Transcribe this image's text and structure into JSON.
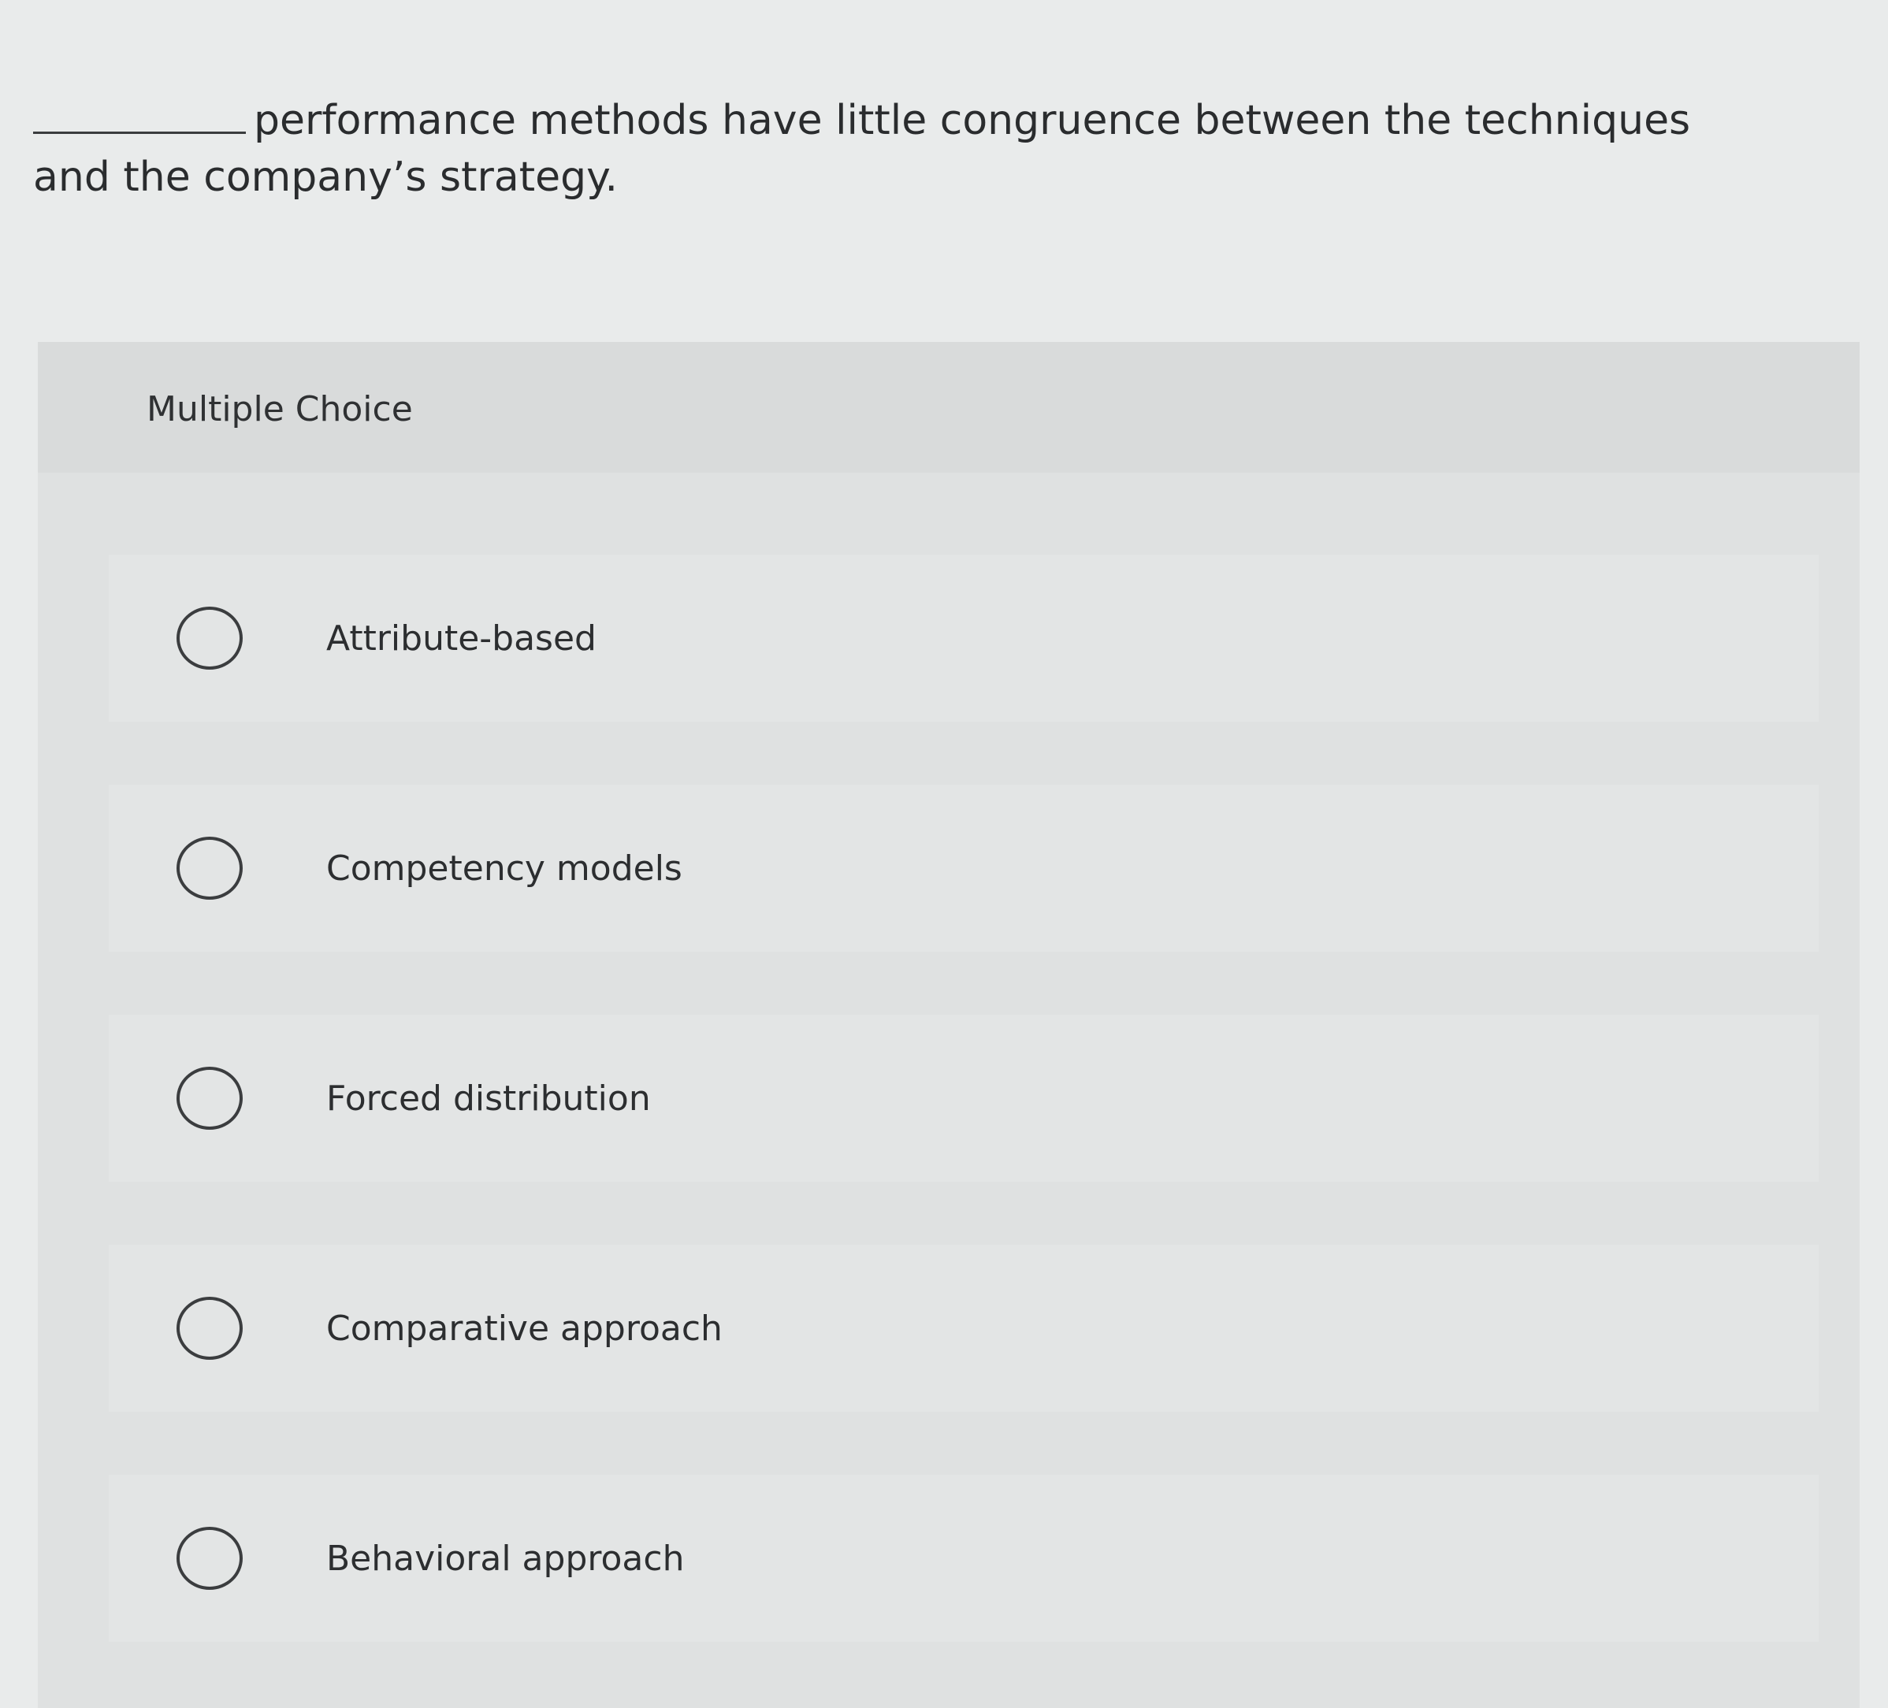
{
  "question": {
    "text": "performance methods have little congruence between the techniques and the company’s strategy."
  },
  "panel": {
    "title": "Multiple Choice"
  },
  "options": [
    {
      "label": "Attribute-based"
    },
    {
      "label": "Competency models"
    },
    {
      "label": "Forced distribution"
    },
    {
      "label": "Comparative approach"
    },
    {
      "label": "Behavioral approach"
    }
  ]
}
